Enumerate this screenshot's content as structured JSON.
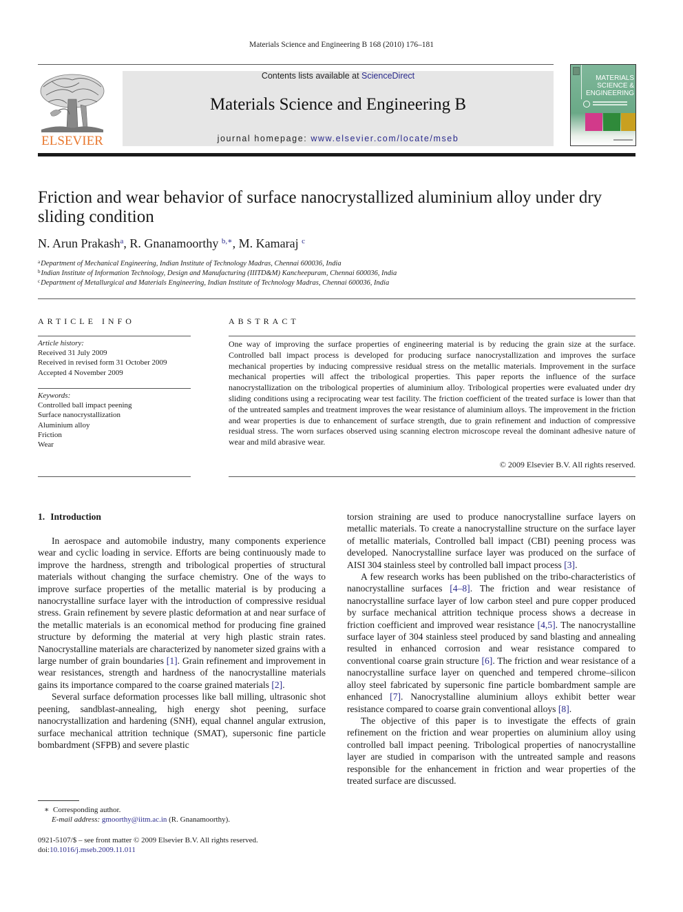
{
  "running_head": "Materials Science and Engineering B 168 (2010) 176–181",
  "header": {
    "publisher_logo_text": "ELSEVIER",
    "contents_prefix": "Contents lists available at ",
    "contents_link": "ScienceDirect",
    "journal_title": "Materials Science and Engineering B",
    "homepage_prefix": "journal homepage: ",
    "homepage_link": "www.elsevier.com/locate/mseb",
    "cover": {
      "line1": "MATERIALS",
      "line2": "SCIENCE &",
      "line3": "ENGINEERING",
      "colors": [
        "#d23a8a",
        "#2f8a3a",
        "#c9a020"
      ]
    }
  },
  "article": {
    "title": "Friction and wear behavior of surface nanocrystallized aluminium alloy under dry sliding condition",
    "authors": [
      {
        "name": "N. Arun Prakash",
        "sup": "a"
      },
      {
        "name": "R. Gnanamoorthy",
        "sup": "b,∗"
      },
      {
        "name": "M. Kamaraj",
        "sup": "c"
      }
    ],
    "affiliations": [
      {
        "sup": "a",
        "text": "Department of Mechanical Engineering, Indian Institute of Technology Madras, Chennai 600036, India"
      },
      {
        "sup": "b",
        "text": "Indian Institute of Information Technology, Design and Manufacturing (IIITD&M) Kancheepuram, Chennai 600036, India"
      },
      {
        "sup": "c",
        "text": "Department of Metallurgical and Materials Engineering, Indian Institute of Technology Madras, Chennai 600036, India"
      }
    ]
  },
  "article_info": {
    "label": "ARTICLE INFO",
    "history_label": "Article history:",
    "history": [
      "Received 31 July 2009",
      "Received in revised form 31 October 2009",
      "Accepted 4 November 2009"
    ],
    "keywords_label": "Keywords:",
    "keywords": [
      "Controlled ball impact peening",
      "Surface nanocrystallization",
      "Aluminium alloy",
      "Friction",
      "Wear"
    ]
  },
  "abstract": {
    "label": "ABSTRACT",
    "text": "One way of improving the surface properties of engineering material is by reducing the grain size at the surface. Controlled ball impact process is developed for producing surface nanocrystallization and improves the surface mechanical properties by inducing compressive residual stress on the metallic materials. Improvement in the surface mechanical properties will affect the tribological properties. This paper reports the influence of the surface nanocrystallization on the tribological properties of aluminium alloy. Tribological properties were evaluated under dry sliding conditions using a reciprocating wear test facility. The friction coefficient of the treated surface is lower than that of the untreated samples and treatment improves the wear resistance of aluminium alloys. The improvement in the friction and wear properties is due to enhancement of surface strength, due to grain refinement and induction of compressive residual stress. The worn surfaces observed using scanning electron microscope reveal the dominant adhesive nature of wear and mild abrasive wear.",
    "copyright": "© 2009 Elsevier B.V. All rights reserved."
  },
  "introduction": {
    "number": "1.",
    "heading": "Introduction",
    "left_col": {
      "p1_a": "In aerospace and automobile industry, many components experience wear and cyclic loading in service. Efforts are being continuously made to improve the hardness, strength and tribological properties of structural materials without changing the surface chemistry. One of the ways to improve surface properties of the metallic material is by producing a nanocrystalline surface layer with the introduction of compressive residual stress. Grain refinement by severe plastic deformation at and near surface of the metallic materials is an economical method for producing fine grained structure by deforming the material at very high plastic strain rates. Nanocrystalline materials are characterized by nanometer sized grains with a large number of grain boundaries ",
      "ref1": "[1]",
      "p1_b": ". Grain refinement and improvement in wear resistances, strength and hardness of the nanocrystalline materials gains its importance compared to the coarse grained materials ",
      "ref2": "[2]",
      "p1_c": ".",
      "p2": "Several surface deformation processes like ball milling, ultrasonic shot peening, sandblast-annealing, high energy shot peening, surface nanocrystallization and hardening (SNH), equal channel angular extrusion, surface mechanical attrition technique (SMAT), supersonic fine particle bombardment (SFPB) and severe plastic"
    },
    "right_col": {
      "p1_a": "torsion straining are used to produce nanocrystalline surface layers on metallic materials. To create a nanocrystalline structure on the surface layer of metallic materials, Controlled ball impact (CBI) peening process was developed. Nanocrystalline surface layer was produced on the surface of AISI 304 stainless steel by controlled ball impact process ",
      "ref3": "[3]",
      "p1_b": ".",
      "p2_a": "A few research works has been published on the tribo-characteristics of nanocrystalline surfaces ",
      "ref4_8": "[4–8]",
      "p2_b": ". The friction and wear resistance of nanocrystalline surface layer of low carbon steel and pure copper produced by surface mechanical attrition technique process shows a decrease in friction coefficient and improved wear resistance ",
      "ref4_5": "[4,5]",
      "p2_c": ". The nanocrystalline surface layer of 304 stainless steel produced by sand blasting and annealing resulted in enhanced corrosion and wear resistance compared to conventional coarse grain structure ",
      "ref6": "[6]",
      "p2_d": ". The friction and wear resistance of a nanocrystalline surface layer on quenched and tempered chrome–silicon alloy steel fabricated by supersonic fine particle bombardment sample are enhanced ",
      "ref7": "[7]",
      "p2_e": ". Nanocrystalline aluminium alloys exhibit better wear resistance compared to coarse grain conventional alloys ",
      "ref8": "[8]",
      "p2_f": ".",
      "p3": "The objective of this paper is to investigate the effects of grain refinement on the friction and wear properties on aluminium alloy using controlled ball impact peening. Tribological properties of nanocrystalline layer are studied in comparison with the untreated sample and reasons responsible for the enhancement in friction and wear properties of the treated surface are discussed."
    }
  },
  "footnotes": {
    "corresponding_mark": "∗",
    "corresponding": "Corresponding author.",
    "email_label": "E-mail address:",
    "email": "gmoorthy@iitm.ac.in",
    "email_owner": " (R. Gnanamoorthy).",
    "front_matter": "0921-5107/$ – see front matter © 2009 Elsevier B.V. All rights reserved.",
    "doi_label": "doi:",
    "doi": "10.1016/j.mseb.2009.11.011"
  }
}
